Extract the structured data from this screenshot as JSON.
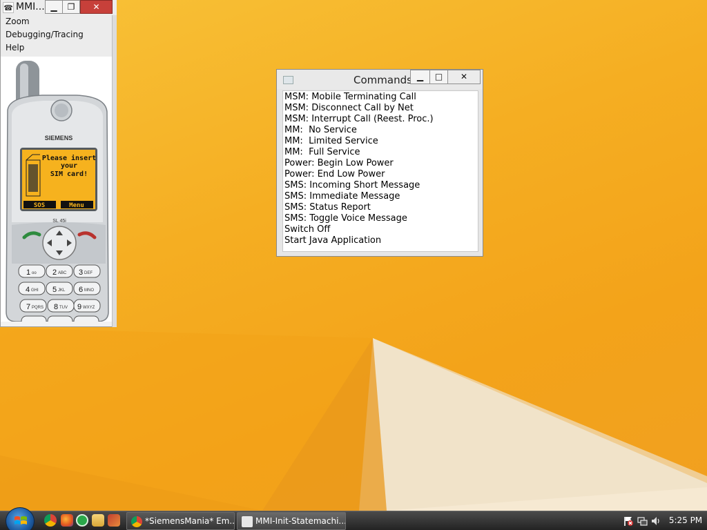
{
  "mmi_window": {
    "title": "MMI...",
    "controls": {
      "minimize": "▁",
      "maximize": "❐",
      "close": "✕"
    },
    "menu": [
      "Zoom",
      "Debugging/Tracing",
      "Help"
    ],
    "phone": {
      "brand": "SIEMENS",
      "model": "SL 45i",
      "screen_lines": [
        "Please insert",
        "your",
        "SIM card!"
      ],
      "softkeys": {
        "left": "SOS",
        "right": "Menu"
      },
      "keys": [
        {
          "digit": "1",
          "sub": "oo"
        },
        {
          "digit": "2",
          "sub": "ABC"
        },
        {
          "digit": "3",
          "sub": "DEF"
        },
        {
          "digit": "4",
          "sub": "GHI"
        },
        {
          "digit": "5",
          "sub": "JKL"
        },
        {
          "digit": "6",
          "sub": "MNO"
        },
        {
          "digit": "7",
          "sub": "PQRS"
        },
        {
          "digit": "8",
          "sub": "TUV"
        },
        {
          "digit": "9",
          "sub": "WXYZ"
        }
      ],
      "screen_color": "#f6b21e"
    }
  },
  "commands_window": {
    "title": "Commands",
    "controls": {
      "minimize": "▁",
      "maximize": "□",
      "close": "✕"
    },
    "items": [
      "MSM: Mobile Terminating Call",
      "MSM: Disconnect Call by Net",
      "MSM: Interrupt Call (Reest. Proc.)",
      "MM:  No Service",
      "MM:  Limited Service",
      "MM:  Full Service",
      "Power: Begin Low Power",
      "Power: End Low Power",
      "SMS: Incoming Short Message",
      "SMS: Immediate Message",
      "SMS: Status Report",
      "SMS: Toggle Voice Message",
      "Switch Off",
      "Start Java Application"
    ]
  },
  "taskbar": {
    "quick_launch_icons": [
      "chrome-icon",
      "firefox-icon",
      "utorrent-icon",
      "explorer-icon",
      "tool-icon"
    ],
    "tasks": [
      {
        "label": "*SiemensMania* Em...",
        "icon": "chrome-icon"
      },
      {
        "label": "MMI-Init-Statemachi...",
        "icon": "app-icon"
      }
    ],
    "tray_icons": [
      "action-center-flag-icon",
      "network-icon",
      "volume-icon"
    ],
    "clock": "5:25 PM"
  },
  "colors": {
    "wallpaper": "#f5a81c",
    "taskbar": "#2e2e2e",
    "close_button": "#c7403a"
  }
}
